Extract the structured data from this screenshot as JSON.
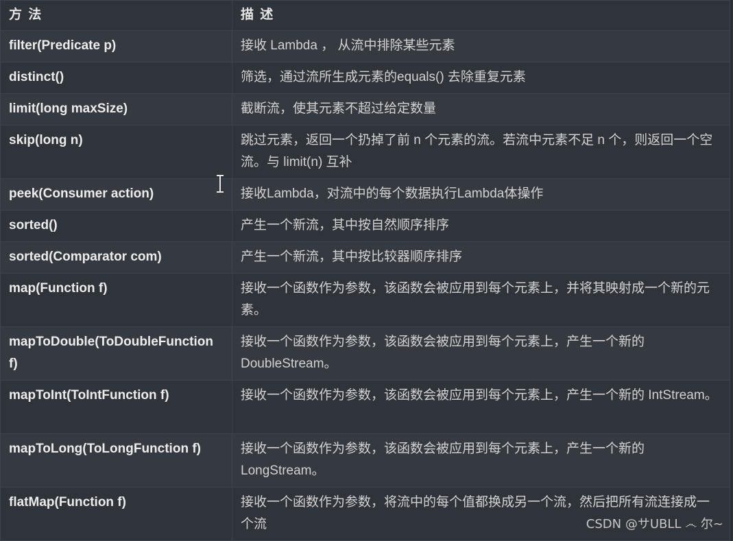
{
  "table": {
    "headers": {
      "method": "方 法",
      "description": "描 述"
    },
    "rows": [
      {
        "method": "filter(Predicate p)",
        "description": "接收 Lambda ， 从流中排除某些元素"
      },
      {
        "method": "distinct()",
        "description": "筛选，通过流所生成元素的equals() 去除重复元素"
      },
      {
        "method": "limit(long maxSize)",
        "description": "截断流，使其元素不超过给定数量"
      },
      {
        "method": "skip(long n)",
        "description": "跳过元素，返回一个扔掉了前 n 个元素的流。若流中元素不足 n 个，则返回一个空流。与 limit(n) 互补"
      },
      {
        "method": "peek(Consumer action)",
        "description": "接收Lambda，对流中的每个数据执行Lambda体操作"
      },
      {
        "method": "sorted()",
        "description": "产生一个新流，其中按自然顺序排序"
      },
      {
        "method": "sorted(Comparator com)",
        "description": "产生一个新流，其中按比较器顺序排序"
      },
      {
        "method": "map(Function f)",
        "description": "接收一个函数作为参数，该函数会被应用到每个元素上，并将其映射成一个新的元素。"
      },
      {
        "method": "mapToDouble(ToDoubleFunction f)",
        "description": "接收一个函数作为参数，该函数会被应用到每个元素上，产生一个新的 DoubleStream。"
      },
      {
        "method": "mapToInt(ToIntFunction f)",
        "description": "接收一个函数作为参数，该函数会被应用到每个元素上，产生一个新的 IntStream。"
      },
      {
        "method": "mapToLong(ToLongFunction f)",
        "description": "接收一个函数作为参数，该函数会被应用到每个元素上，产生一个新的 LongStream。"
      },
      {
        "method": "flatMap(Function f)",
        "description": "接收一个函数作为参数，将流中的每个值都换成另一个流，然后把所有流连接成一个流"
      }
    ]
  },
  "watermark": "CSDN @サUBLL ෴ 尔~",
  "colors": {
    "background": "#2b2f36",
    "row_odd": "#353a41",
    "row_even": "#2f333a",
    "border": "#3f444c",
    "text": "#d6d6d6"
  },
  "icons": {
    "cursor": "text-cursor-icon"
  }
}
